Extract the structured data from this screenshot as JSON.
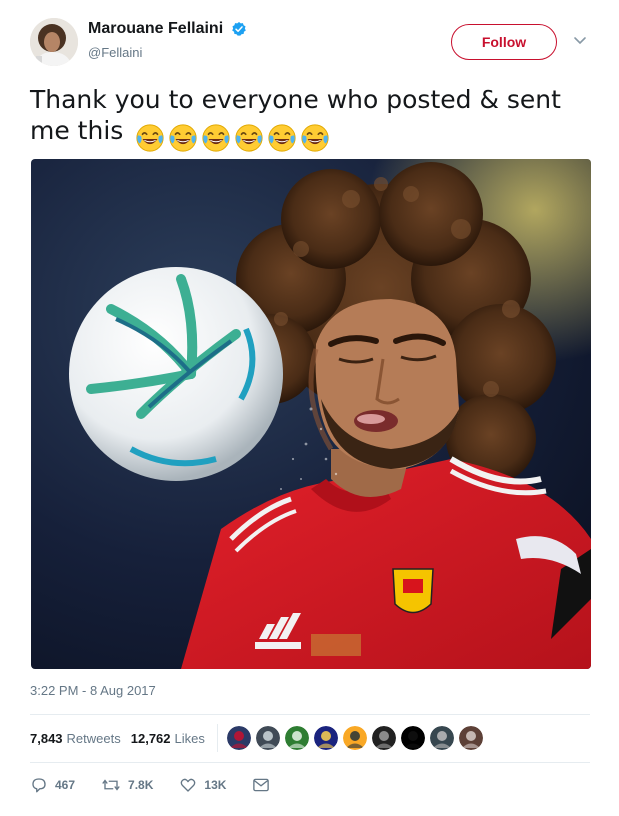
{
  "tweet": {
    "author": {
      "display_name": "Marouane Fellaini",
      "handle": "@Fellaini",
      "verified": true,
      "avatar_icon": "avatar-photo"
    },
    "follow_label": "Follow",
    "menu_icon": "chevron-down-icon",
    "text_line1": "Thank you to everyone who posted & sent",
    "text_line2": "me this",
    "emoji": [
      "face-with-tears-of-joy",
      "face-with-tears-of-joy",
      "face-with-tears-of-joy",
      "face-with-tears-of-joy",
      "face-with-tears-of-joy",
      "face-with-tears-of-joy"
    ],
    "media": {
      "kind": "photo"
    },
    "timestamp": "3:22 PM - 8 Aug 2017",
    "stats": {
      "retweets_count": "7,843",
      "retweets_label": "Retweets",
      "likes_count": "12,762",
      "likes_label": "Likes",
      "likers_shown": 9
    },
    "actions": {
      "reply_count": "467",
      "retweet_count": "7.8K",
      "like_count": "13K",
      "message_icon": "envelope-icon"
    },
    "colors": {
      "accent": "#c8102e",
      "verified": "#1da1f2",
      "secondary_text": "#657786",
      "divider": "#e6ecf0"
    }
  }
}
